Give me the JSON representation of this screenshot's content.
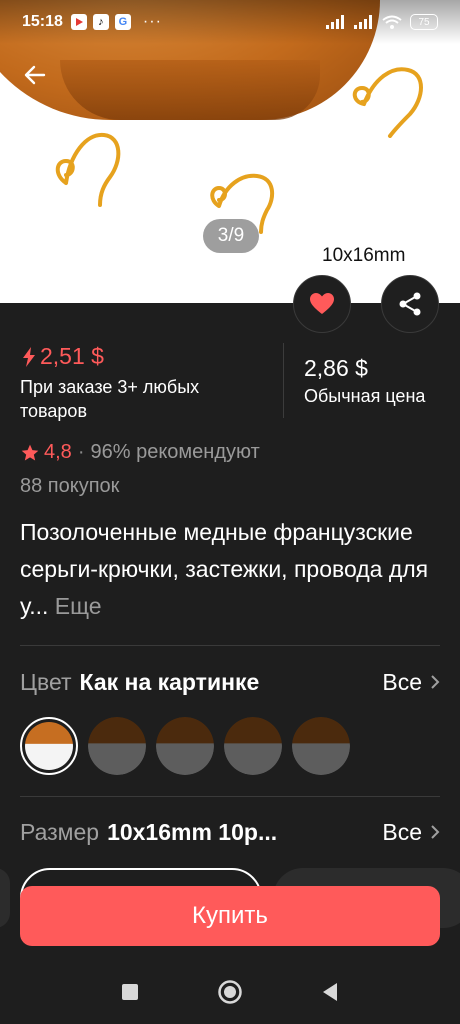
{
  "status_bar": {
    "time": "15:18",
    "battery": "75"
  },
  "gallery": {
    "counter": "3/9",
    "size_caption": "10x16mm"
  },
  "price": {
    "promo_price": "2,51 $",
    "promo_note": "При заказе 3+ любых товаров",
    "regular_price": "2,86 $",
    "regular_note": "Обычная цена"
  },
  "rating": {
    "value": "4,8",
    "separator": "·",
    "recommend": "96% рекомендуют",
    "purchases": "88 покупок"
  },
  "product": {
    "title": "Позолоченные медные французские серьги-крючки, застежки, провода для у...",
    "more_label": "Еще"
  },
  "color_option": {
    "label": "Цвет",
    "value": "Как на картинке",
    "all_label": "Все",
    "swatch_count": 5,
    "selected_index": 0
  },
  "size_option": {
    "label": "Размер",
    "value": "10x16mm 10p...",
    "all_label": "Все"
  },
  "buy_button": {
    "label": "Купить"
  },
  "colors": {
    "accent": "#ff5a5a",
    "background": "#1e1e1e",
    "muted_text": "#9a9a9a"
  }
}
